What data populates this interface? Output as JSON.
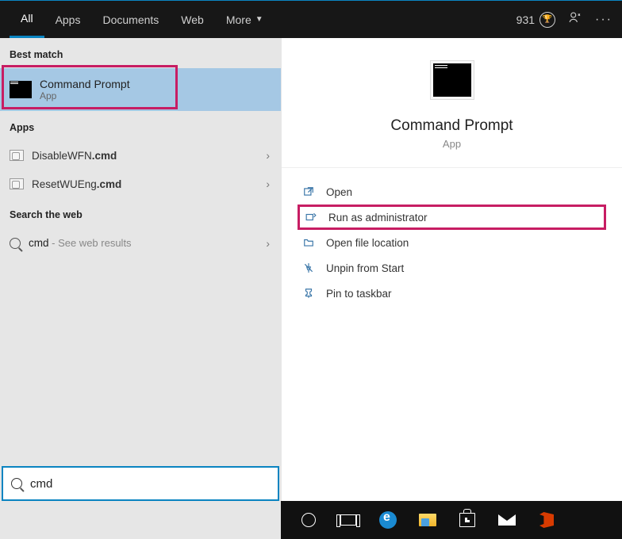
{
  "topbar": {
    "tabs": [
      "All",
      "Apps",
      "Documents",
      "Web",
      "More"
    ],
    "points": "931"
  },
  "left": {
    "sections": {
      "best_match": "Best match",
      "apps": "Apps",
      "web": "Search the web"
    },
    "best_match_item": {
      "title": "Command Prompt",
      "subtitle": "App"
    },
    "apps_items": [
      {
        "prefix": "DisableWFN",
        "suffix": ".cmd"
      },
      {
        "prefix": "ResetWUEng",
        "suffix": ".cmd"
      }
    ],
    "web_item": {
      "query": "cmd",
      "suffix": " - See web results"
    }
  },
  "right": {
    "title": "Command Prompt",
    "subtitle": "App",
    "actions": [
      "Open",
      "Run as administrator",
      "Open file location",
      "Unpin from Start",
      "Pin to taskbar"
    ]
  },
  "search": {
    "value": "cmd"
  }
}
